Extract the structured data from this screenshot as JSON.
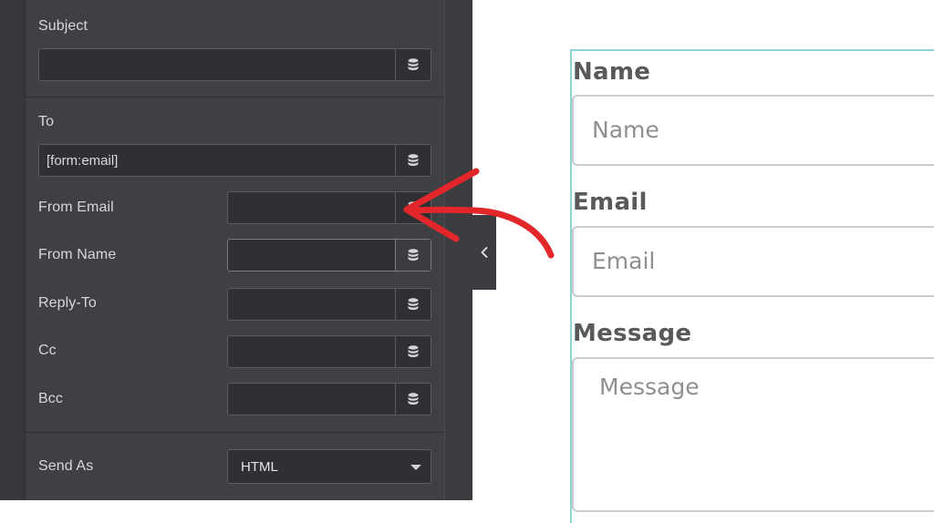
{
  "panel": {
    "subject_label": "Subject",
    "subject_value": "",
    "to_label": "To",
    "to_value": "[form:email]",
    "fields": [
      {
        "label": "From Email",
        "value": ""
      },
      {
        "label": "From Name",
        "value": ""
      },
      {
        "label": "Reply-To",
        "value": ""
      },
      {
        "label": "Cc",
        "value": ""
      },
      {
        "label": "Bcc",
        "value": ""
      }
    ],
    "send_as_label": "Send As",
    "send_as_value": "HTML",
    "dynamic_icon": "database-icon",
    "collapse_icon": "chevron-left-icon"
  },
  "form": {
    "name_label": "Name",
    "name_placeholder": "Name",
    "email_label": "Email",
    "email_placeholder": "Email",
    "message_label": "Message",
    "message_placeholder": "Message"
  },
  "colors": {
    "panel_bg": "#3e4043",
    "accent_arrow": "#e3262a",
    "preview_border": "#8fd3d8"
  }
}
